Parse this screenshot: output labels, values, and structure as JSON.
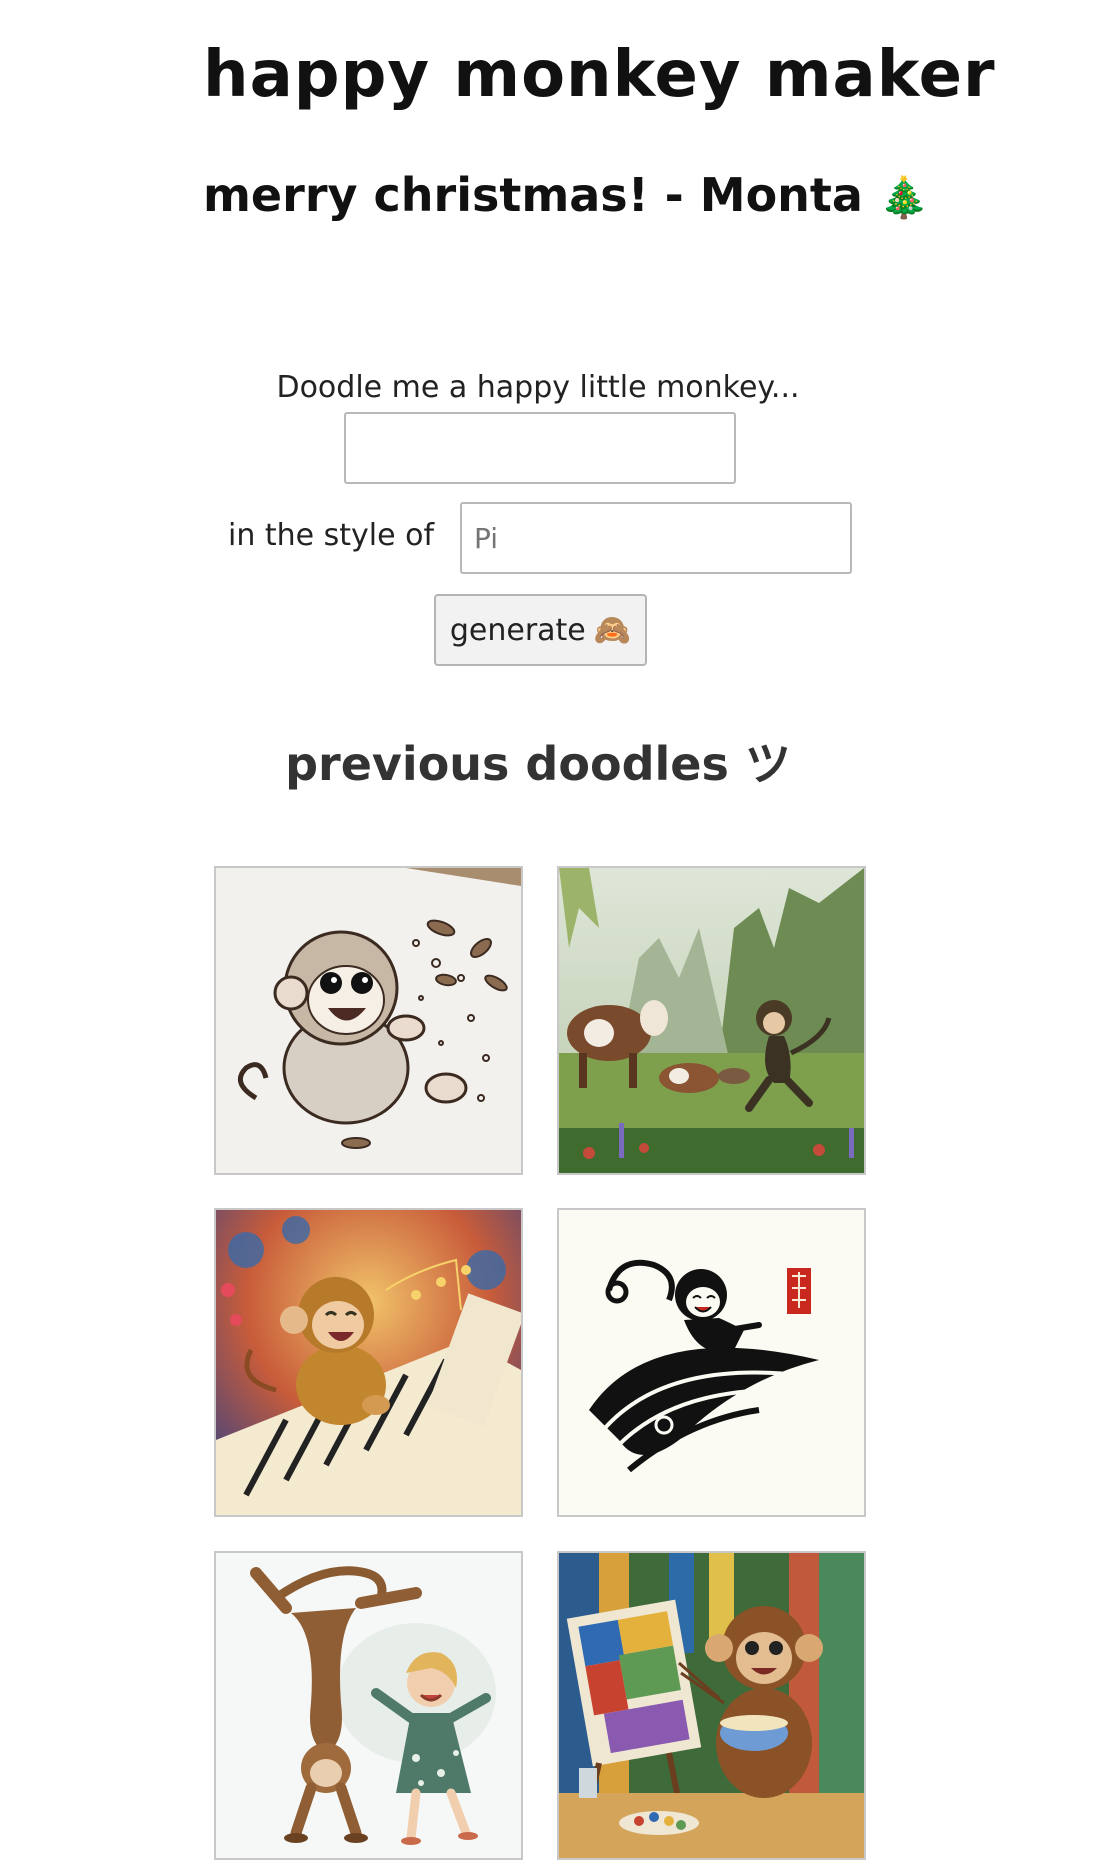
{
  "header": {
    "title": "happy monkey maker",
    "subtitle": "merry christmas! - Monta",
    "subtitle_icon": "🎄"
  },
  "form": {
    "prompt_label": "Doodle me a happy little monkey...",
    "prompt_value": "",
    "style_label": "in the style of",
    "style_placeholder": "Pi",
    "generate_label": "generate",
    "generate_icon": "🙈"
  },
  "gallery": {
    "title": "previous doodles ツ",
    "items": [
      {
        "icon": "sketch-monkey-image"
      },
      {
        "icon": "jungle-monkey-cows-image"
      },
      {
        "icon": "piano-monkey-image"
      },
      {
        "icon": "ink-monkey-image"
      },
      {
        "icon": "handstand-monkey-girl-image"
      },
      {
        "icon": "painter-monkey-noodles-image"
      }
    ]
  },
  "colors": {
    "text": "#111111",
    "input_border": "#b9b9b9",
    "button_bg": "#f2f2f2",
    "thumb_border": "#c8c8c8"
  }
}
